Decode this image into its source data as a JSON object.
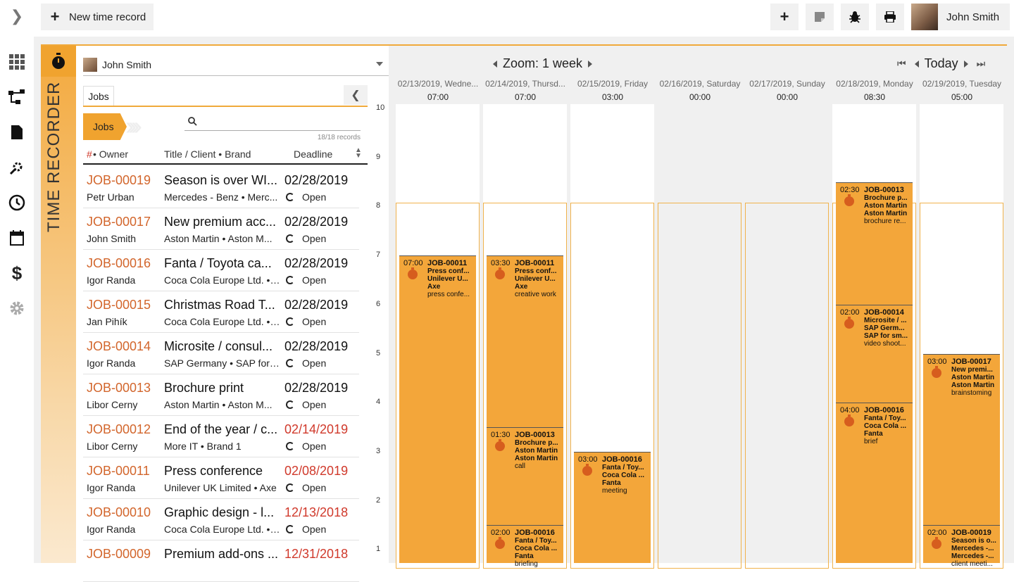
{
  "toolbar": {
    "new_time_record_label": "New time record",
    "user_name": "John Smith"
  },
  "recorder": {
    "label": "TIME RECORDER",
    "selected_user": "John Smith"
  },
  "jobs_panel": {
    "tab_label": "Jobs",
    "chip_label": "Jobs",
    "search_placeholder": "",
    "record_count": "18/18 records",
    "headers": {
      "num": "#",
      "owner": " • Owner",
      "title": "Title / Client • Brand",
      "deadline": "Deadline"
    },
    "rows": [
      {
        "id": "JOB-00019",
        "title": "Season is over WI...",
        "date": "02/28/2019",
        "late": false,
        "owner": "Petr Urban",
        "client": "Mercedes - Benz • Merc...",
        "status": "Open"
      },
      {
        "id": "JOB-00017",
        "title": "New premium acc...",
        "date": "02/28/2019",
        "late": false,
        "owner": "John Smith",
        "client": "Aston Martin • Aston M...",
        "status": "Open"
      },
      {
        "id": "JOB-00016",
        "title": "Fanta / Toyota ca...",
        "date": "02/28/2019",
        "late": false,
        "owner": "Igor Randa",
        "client": "Coca Cola Europe Ltd. • ...",
        "status": "Open"
      },
      {
        "id": "JOB-00015",
        "title": "Christmas Road T...",
        "date": "02/28/2019",
        "late": false,
        "owner": "Jan Pihík",
        "client": "Coca Cola Europe Ltd. • ...",
        "status": "Open"
      },
      {
        "id": "JOB-00014",
        "title": "Microsite / consul...",
        "date": "02/28/2019",
        "late": false,
        "owner": "Igor Randa",
        "client": "SAP Germany • SAP for ...",
        "status": "Open"
      },
      {
        "id": "JOB-00013",
        "title": "Brochure print",
        "date": "02/28/2019",
        "late": false,
        "owner": "Libor Cerny",
        "client": "Aston Martin • Aston M...",
        "status": "Open"
      },
      {
        "id": "JOB-00012",
        "title": "End of the year / c...",
        "date": "02/14/2019",
        "late": true,
        "owner": "Libor Cerny",
        "client": "More IT • Brand 1",
        "status": "Open"
      },
      {
        "id": "JOB-00011",
        "title": "Press conference",
        "date": "02/08/2019",
        "late": true,
        "owner": "Igor Randa",
        "client": "Unilever UK Limited • Axe",
        "status": "Open"
      },
      {
        "id": "JOB-00010",
        "title": "Graphic design - l...",
        "date": "12/13/2018",
        "late": true,
        "owner": "Igor Randa",
        "client": "Coca Cola Europe Ltd. • ...",
        "status": "Open"
      },
      {
        "id": "JOB-00009",
        "title": "Premium add-ons ...",
        "date": "12/31/2018",
        "late": true,
        "owner": "",
        "client": "",
        "status": ""
      }
    ]
  },
  "calendar": {
    "zoom_label": "Zoom: 1 week",
    "today_label": "Today",
    "days": [
      {
        "head": "02/13/2019, Wedne...",
        "time": "07:00"
      },
      {
        "head": "02/14/2019, Thursd...",
        "time": "07:00"
      },
      {
        "head": "02/15/2019, Friday",
        "time": "03:00"
      },
      {
        "head": "02/16/2019, Saturday",
        "time": "00:00"
      },
      {
        "head": "02/17/2019, Sunday",
        "time": "00:00"
      },
      {
        "head": "02/18/2019, Monday",
        "time": "08:30"
      },
      {
        "head": "02/19/2019, Tuesday",
        "time": "05:00"
      }
    ],
    "axis": [
      "10",
      "9",
      "8",
      "7",
      "6",
      "5",
      "4",
      "3",
      "2",
      "1"
    ],
    "events": [
      {
        "time": "07:00",
        "job": "JOB-00011",
        "l1": "Press conf...",
        "l2": "Unilever U...",
        "l3": "Axe",
        "note": "press confe..."
      },
      {
        "time": "03:30",
        "job": "JOB-00011",
        "l1": "Press conf...",
        "l2": "Unilever U...",
        "l3": "Axe",
        "note": "creative work"
      },
      {
        "time": "01:30",
        "job": "JOB-00013",
        "l1": "Brochure p...",
        "l2": "Aston Martin",
        "l3": "Aston Martin",
        "note": "call"
      },
      {
        "time": "02:00",
        "job": "JOB-00016",
        "l1": "Fanta / Toy...",
        "l2": "Coca Cola ...",
        "l3": "Fanta",
        "note": "briefing"
      },
      {
        "time": "03:00",
        "job": "JOB-00016",
        "l1": "Fanta / Toy...",
        "l2": "Coca Cola ...",
        "l3": "Fanta",
        "note": "meeting"
      },
      {
        "time": "02:30",
        "job": "JOB-00013",
        "l1": "Brochure p...",
        "l2": "Aston Martin",
        "l3": "Aston Martin",
        "note": "brochure re..."
      },
      {
        "time": "02:00",
        "job": "JOB-00014",
        "l1": "Microsite / ...",
        "l2": "SAP Germ...",
        "l3": "SAP for sm...",
        "note": "video shoot..."
      },
      {
        "time": "04:00",
        "job": "JOB-00016",
        "l1": "Fanta / Toy...",
        "l2": "Coca Cola ...",
        "l3": "Fanta",
        "note": "brief"
      },
      {
        "time": "03:00",
        "job": "JOB-00017",
        "l1": "New premi...",
        "l2": "Aston Martin",
        "l3": "Aston Martin",
        "note": "brainstoming"
      },
      {
        "time": "02:00",
        "job": "JOB-00019",
        "l1": "Season is o...",
        "l2": "Mercedes -...",
        "l3": "Mercedes -...",
        "note": "client meeti..."
      }
    ]
  }
}
